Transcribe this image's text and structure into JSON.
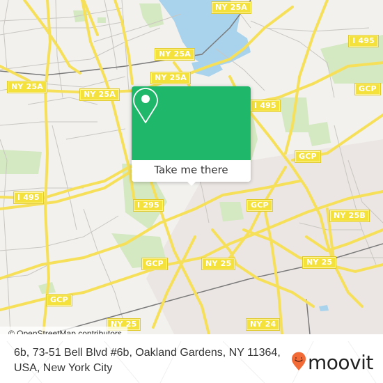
{
  "map": {
    "colors": {
      "background": "#f2f1ee",
      "water": "#a9d3ec",
      "park": "#d4e8c1",
      "urban": "#e9e4e1",
      "road_major": "#f6e05a",
      "road_minor": "#c9c6c1",
      "rail": "#7a7a7a",
      "shield": "#f4e13b"
    },
    "shields": [
      {
        "label": "NY 25A"
      },
      {
        "label": "NY 25A"
      },
      {
        "label": "NY 25A"
      },
      {
        "label": "NY 25A"
      },
      {
        "label": "I 495"
      },
      {
        "label": "I 495"
      },
      {
        "label": "I 495"
      },
      {
        "label": "I 295"
      },
      {
        "label": "GCP"
      },
      {
        "label": "GCP"
      },
      {
        "label": "GCP"
      },
      {
        "label": "GCP"
      },
      {
        "label": "GCP"
      },
      {
        "label": "NY 25B"
      },
      {
        "label": "NY 25"
      },
      {
        "label": "NY 25"
      },
      {
        "label": "NY 25"
      },
      {
        "label": "NY 24"
      }
    ],
    "attribution": "© OpenStreetMap contributors"
  },
  "popup": {
    "icon": "map-pin-icon",
    "button_label": "Take me there",
    "color": "#1fb769"
  },
  "footer": {
    "address": "6b, 73-51 Bell Blvd #6b, Oakland Gardens, NY 11364, USA, New York City",
    "logo_text": "moovit",
    "logo_icon": "moovit-pin-icon",
    "logo_color": "#f26a36"
  }
}
